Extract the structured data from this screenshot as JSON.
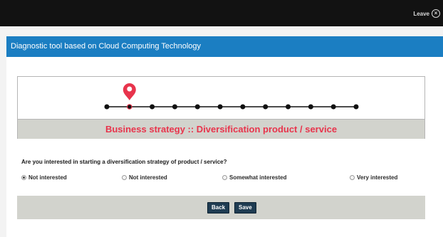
{
  "topbar": {
    "leave_label": "Leave",
    "close_icon": "close-circle-icon"
  },
  "panel": {
    "title": "Diagnostic tool based on Cloud Computing Technology"
  },
  "progress": {
    "steps_total": 12,
    "current_step": 2,
    "marker_color": "#e8344c",
    "marker_icon": "map-pin-icon",
    "step_title": "Business strategy :: Diversification product / service"
  },
  "question": {
    "text": "Are you interested in starting a diversification strategy of product / service?",
    "options": [
      {
        "label": "Not interested",
        "selected": true
      },
      {
        "label": "Not interested",
        "selected": false
      },
      {
        "label": "Somewhat interested",
        "selected": false
      },
      {
        "label": "Very interested",
        "selected": false
      }
    ]
  },
  "actions": {
    "back_label": "Back",
    "save_label": "Save"
  },
  "colors": {
    "header_blue": "#1b7ec2",
    "accent_red": "#e8344c",
    "button_navy": "#1f3c52",
    "band_gray": "#d2d3cd"
  }
}
